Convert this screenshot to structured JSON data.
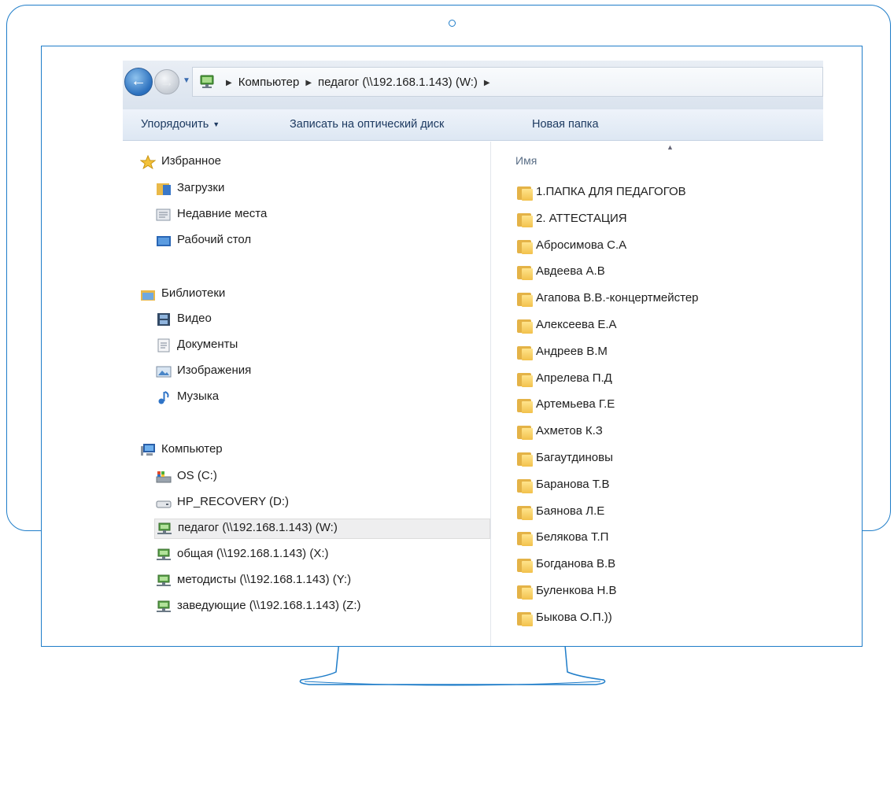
{
  "address": {
    "crumbs": [
      "Компьютер",
      "педагог (\\\\192.168.1.143) (W:)"
    ]
  },
  "toolbar": {
    "organize_label": "Упорядочить",
    "burn_label": "Записать на оптический диск",
    "new_folder_label": "Новая папка"
  },
  "nav": {
    "favorites": {
      "label": "Избранное",
      "items": [
        {
          "label": "Загрузки",
          "icon": "downloads-icon"
        },
        {
          "label": "Недавние места",
          "icon": "recent-places-icon"
        },
        {
          "label": "Рабочий стол",
          "icon": "desktop-icon"
        }
      ]
    },
    "libraries": {
      "label": "Библиотеки",
      "items": [
        {
          "label": "Видео",
          "icon": "video-icon"
        },
        {
          "label": "Документы",
          "icon": "documents-icon"
        },
        {
          "label": "Изображения",
          "icon": "pictures-icon"
        },
        {
          "label": "Музыка",
          "icon": "music-icon"
        }
      ]
    },
    "computer": {
      "label": "Компьютер",
      "items": [
        {
          "label": "OS (C:)",
          "icon": "os-drive-icon",
          "selected": false
        },
        {
          "label": "HP_RECOVERY (D:)",
          "icon": "hard-drive-icon",
          "selected": false
        },
        {
          "label": "педагог (\\\\192.168.1.143) (W:)",
          "icon": "network-drive-icon",
          "selected": true
        },
        {
          "label": "общая (\\\\192.168.1.143) (X:)",
          "icon": "network-drive-icon",
          "selected": false
        },
        {
          "label": "методисты (\\\\192.168.1.143) (Y:)",
          "icon": "network-drive-icon",
          "selected": false
        },
        {
          "label": "заведующие (\\\\192.168.1.143) (Z:)",
          "icon": "network-drive-icon",
          "selected": false
        }
      ]
    }
  },
  "content": {
    "column_name": "Имя",
    "folders": [
      "1.ПАПКА ДЛЯ ПЕДАГОГОВ",
      "2. АТТЕСТАЦИЯ",
      "Абросимова С.А",
      "Авдеева А.В",
      "Агапова В.В.-концертмейстер",
      "Алексеева Е.А",
      "Андреев В.М",
      "Апрелева П.Д",
      "Артемьева Г.Е",
      "Ахметов К.З",
      "Багаутдиновы",
      "Баранова Т.В",
      "Баянова Л.Е",
      "Белякова Т.П",
      "Богданова В.В",
      "Буленкова Н.В",
      "Быкова О.П.))"
    ]
  },
  "colors": {
    "frame": "#1f7dc9",
    "toolbar_text": "#1d3a61",
    "folder": "#f2c14c"
  }
}
